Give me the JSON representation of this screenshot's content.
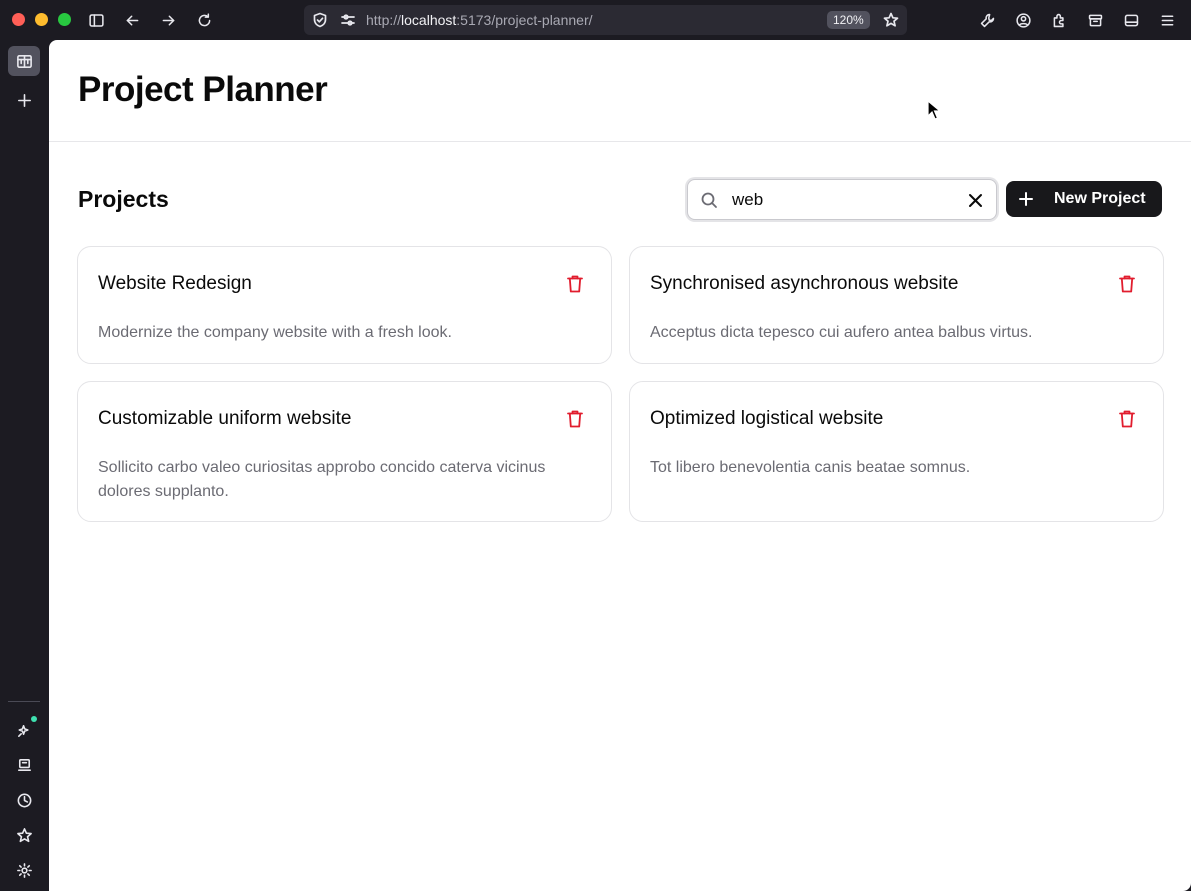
{
  "browser": {
    "url_scheme": "http://",
    "url_host": "localhost",
    "url_path": ":5173/project-planner/",
    "zoom": "120%"
  },
  "page": {
    "title": "Project Planner",
    "section_title": "Projects"
  },
  "search": {
    "value": "web",
    "placeholder": ""
  },
  "toolbar": {
    "new_project_label": "New Project"
  },
  "projects": [
    {
      "title": "Website Redesign",
      "description": "Modernize the company website with a fresh look."
    },
    {
      "title": "Synchronised asynchronous website",
      "description": "Acceptus dicta tepesco cui aufero antea balbus virtus."
    },
    {
      "title": "Customizable uniform website",
      "description": "Sollicito carbo valeo curiositas approbo concido caterva vicinus dolores supplanto."
    },
    {
      "title": "Optimized logistical website",
      "description": "Tot libero benevolentia canis beatae somnus."
    }
  ],
  "colors": {
    "accent_dark": "#18181b",
    "delete_red": "#e11d2e",
    "chrome_bg": "#1c1b22"
  }
}
